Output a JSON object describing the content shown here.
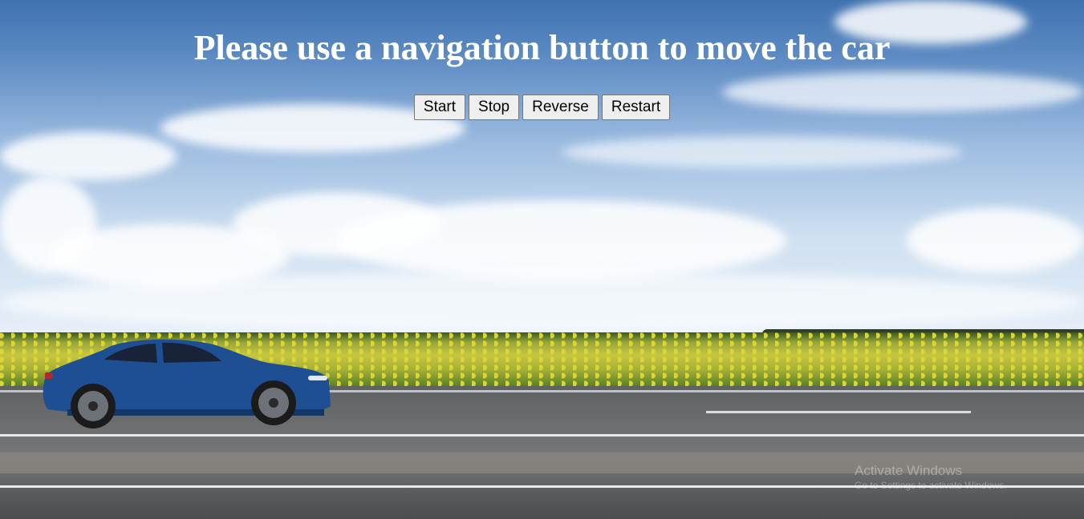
{
  "page": {
    "heading": "Please use a navigation button to move the car"
  },
  "controls": {
    "start_label": "Start",
    "stop_label": "Stop",
    "reverse_label": "Reverse",
    "restart_label": "Restart"
  },
  "scene": {
    "car_icon": "blue-sedan-car-icon",
    "colors": {
      "car_body": "#1f4f93",
      "sky_top": "#3f72b0",
      "field": "#c8c640",
      "road": "#6c6e70"
    }
  },
  "watermark": {
    "title": "Activate Windows",
    "subtitle": "Go to Settings to activate Windows."
  }
}
